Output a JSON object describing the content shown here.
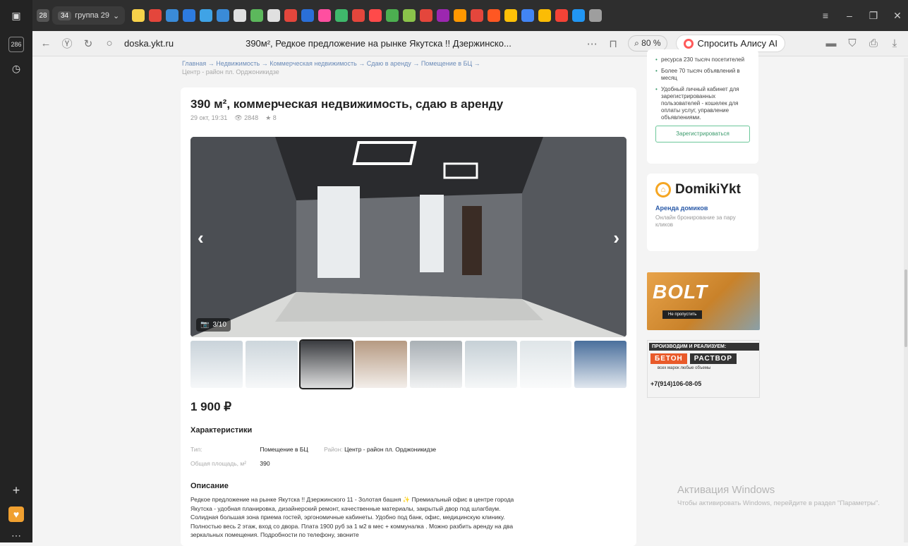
{
  "browser": {
    "tab_count_badge": "28",
    "tab_group": {
      "count": "34",
      "label": "группа 29"
    },
    "url": "doska.ykt.ru",
    "page_title": "390м², Редкое предложение на рынке Якутска !! Дзержинско...",
    "zoom": "80 %",
    "alice_label": "Спросить Алису AI",
    "tab_colors": [
      "#f8d24a",
      "#e4463c",
      "#3a8bd8",
      "#2d7be0",
      "#3fa3e6",
      "#3a8bd8",
      "#e0e0e0",
      "#5cb85c",
      "#e0e0e0",
      "#e4463c",
      "#2a6fd8",
      "#ff4fa0",
      "#3fb86b",
      "#e4463c",
      "#ff4a4a",
      "#4caf50",
      "#8bc34a",
      "#e4463c",
      "#9c27b0",
      "#ff9800",
      "#e4463c",
      "#ff5722",
      "#ffc107",
      "#4285f4",
      "#fbbc05",
      "#f44336",
      "#2196f3",
      "#9e9e9e"
    ]
  },
  "breadcrumb": {
    "items": [
      "Главная",
      "Недвижимость",
      "Коммерческая недвижимость",
      "Сдаю в аренду",
      "Помещение в БЦ"
    ],
    "sub": "Центр - район пл. Орджоникидзе"
  },
  "ad": {
    "title": "390 м², коммерческая недвижимость, сдаю в аренду",
    "date": "29 окт, 19:31",
    "views": "2848",
    "favorites": "8",
    "photo_counter": "3/10",
    "thumb_colors": [
      "#c9d3da",
      "#cdd6dc",
      "#3a3c40",
      "#b69a82",
      "#a9b0b5",
      "#c6d0d6",
      "#dfe5e8",
      "#4a6f9c"
    ],
    "price": "1 900 ₽",
    "characteristics_heading": "Характеристики",
    "chars": {
      "type_label": "Тип:",
      "type_value": "Помещение в БЦ",
      "district_label": "Район:",
      "district_value": "Центр - район пл. Орджоникидзе",
      "area_label": "Общая площадь, м²",
      "area_value": "390"
    },
    "description_heading": "Описание",
    "description": "Редкое предложение на рынке Якутска !! Дзержинского 11 - Золотая башня ✨ Премиальный офис в центре города Якутска - удобная планировка, дизайнерский ремонт, качественные материалы, закрытый двор под шлагбаум. Солидная большая зона приема гостей, эргономичные кабинеты. Удобно под банк, офис, медицинскую клинику. Полностью весь 2 этаж, вход со двора. Плата 1900 руб за 1 м2 в мес + коммуналка . Можно разбить аренду на два зеркальных помещения. Подробности по телефону, звоните"
  },
  "sidebar": {
    "reg_items": [
      "ресурса 230 тысяч посетителей",
      "Более 70 тысяч объявлений в месяц",
      "Удобный личный кабинет для зарегистрированных пользователей - кошелек для оплаты услуг, управление объявлениями."
    ],
    "reg_button": "Зарегистрироваться",
    "domiki_name": "DomikiYkt",
    "domiki_link": "Аренда домиков",
    "domiki_sub": "Онлайн бронирование за пару кликов",
    "bolt_word": "BOLT",
    "bolt_button": "Не пропустить",
    "beton_head": "ПРОИЗВОДИМ И РЕАЛИЗУЕМ:",
    "beton_tag1": "БЕТОН",
    "beton_tag2": "РАСТВОР",
    "beton_sub": "всех марок   любые объемы",
    "beton_phone": "+7(914)106-08-05"
  },
  "windows_activation": {
    "title": "Активация Windows",
    "text": "Чтобы активировать Windows, перейдите в раздел \"Параметры\"."
  }
}
